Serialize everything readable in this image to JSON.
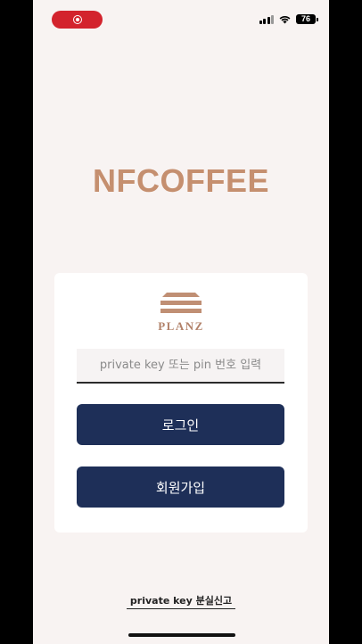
{
  "status_bar": {
    "battery_level": "76",
    "recording_indicator": "record-icon",
    "colors": {
      "recording": "#d3232d"
    }
  },
  "brand": {
    "title": "NFCOFFEE",
    "color": "#c58f6f"
  },
  "card": {
    "logo_text": "PLANZ",
    "logo_icon": "planz-logo-icon",
    "key_input": {
      "placeholder": "private key 또는 pin 번호 입력",
      "value": ""
    },
    "login_label": "로그인",
    "signup_label": "회원가입",
    "button_color": "#1e2f58"
  },
  "footer": {
    "report_label": "private key 분실신고"
  }
}
